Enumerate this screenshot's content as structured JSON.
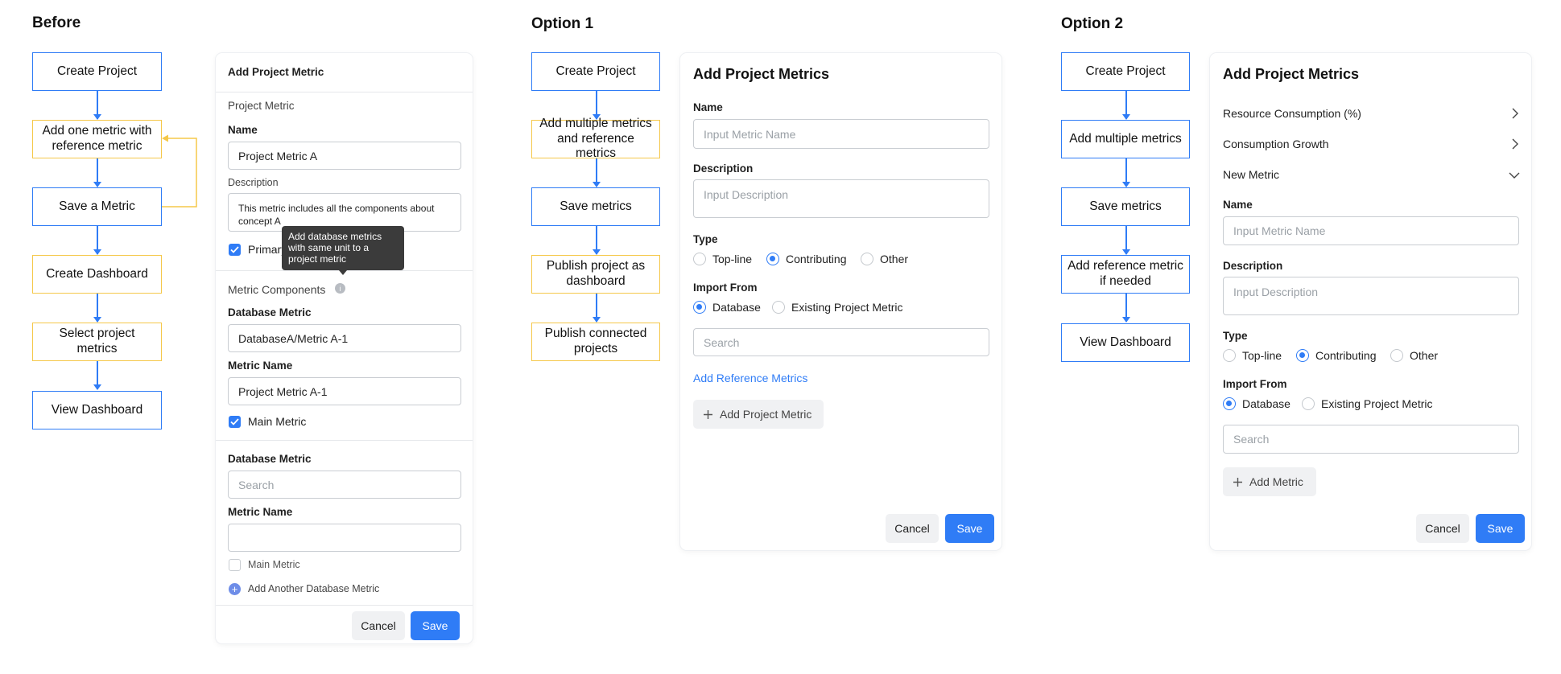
{
  "headings": {
    "before": "Before",
    "option1": "Option 1",
    "option2": "Option 2"
  },
  "before_flow": {
    "steps": [
      "Create Project",
      "Add one metric with reference metric",
      "Save a Metric",
      "Create Dashboard",
      "Select project metrics",
      "View Dashboard"
    ]
  },
  "before_card": {
    "title": "Add Project Metric",
    "section_label": "Project Metric",
    "name_label": "Name",
    "name_value": "Project Metric A",
    "description_label": "Description",
    "description_value": "This metric includes all the components about concept A",
    "primary_label": "Primary Metric",
    "tooltip": "Add database metrics with same unit to a project metric",
    "components_label": "Metric Components",
    "db_metric_label_1": "Database Metric",
    "db_metric_value_1": "DatabaseA/Metric A-1",
    "metric_name_label_1": "Metric Name",
    "metric_name_value_1": "Project Metric A-1",
    "main_metric_label_1": "Main Metric",
    "db_metric_label_2": "Database Metric",
    "db_metric_placeholder_2": "Search",
    "metric_name_label_2": "Metric Name",
    "metric_name_value_2": "",
    "main_metric_label_2": "Main Metric",
    "add_another": "Add Another Database Metric",
    "cancel": "Cancel",
    "save": "Save"
  },
  "option1_flow": {
    "steps": [
      "Create Project",
      "Add multiple metrics and reference metrics",
      "Save metrics",
      "Publish project as dashboard",
      "Publish connected projects"
    ]
  },
  "option1_card": {
    "title": "Add Project Metrics",
    "name_label": "Name",
    "name_placeholder": "Input Metric Name",
    "description_label": "Description",
    "description_placeholder": "Input Description",
    "type_label": "Type",
    "type_options": [
      "Top-line",
      "Contributing",
      "Other"
    ],
    "type_selected": "Contributing",
    "import_label": "Import From",
    "import_options": [
      "Database",
      "Existing Project Metric"
    ],
    "import_selected": "Database",
    "search_placeholder": "Search",
    "add_reference": "Add Reference Metrics",
    "add_project_metric": "Add Project Metric",
    "cancel": "Cancel",
    "save": "Save"
  },
  "option2_flow": {
    "steps": [
      "Create Project",
      "Add multiple metrics",
      "Save metrics",
      "Add reference metric if needed",
      "View Dashboard"
    ]
  },
  "option2_card": {
    "title": "Add Project Metrics",
    "collapsed_items": [
      "Resource Consumption (%)",
      "Consumption Growth"
    ],
    "expanded_item": "New Metric",
    "name_label": "Name",
    "name_placeholder": "Input Metric Name",
    "description_label": "Description",
    "description_placeholder": "Input Description",
    "type_label": "Type",
    "type_options": [
      "Top-line",
      "Contributing",
      "Other"
    ],
    "type_selected": "Contributing",
    "import_label": "Import From",
    "import_options": [
      "Database",
      "Existing Project Metric"
    ],
    "import_selected": "Database",
    "search_placeholder": "Search",
    "add_metric": "Add Metric",
    "cancel": "Cancel",
    "save": "Save"
  },
  "colors": {
    "accent": "#2f7cf6",
    "flow_yellow": "#f5c84a",
    "flow_blue": "#2f7cf6",
    "tooltip": "#3b3b3b"
  }
}
